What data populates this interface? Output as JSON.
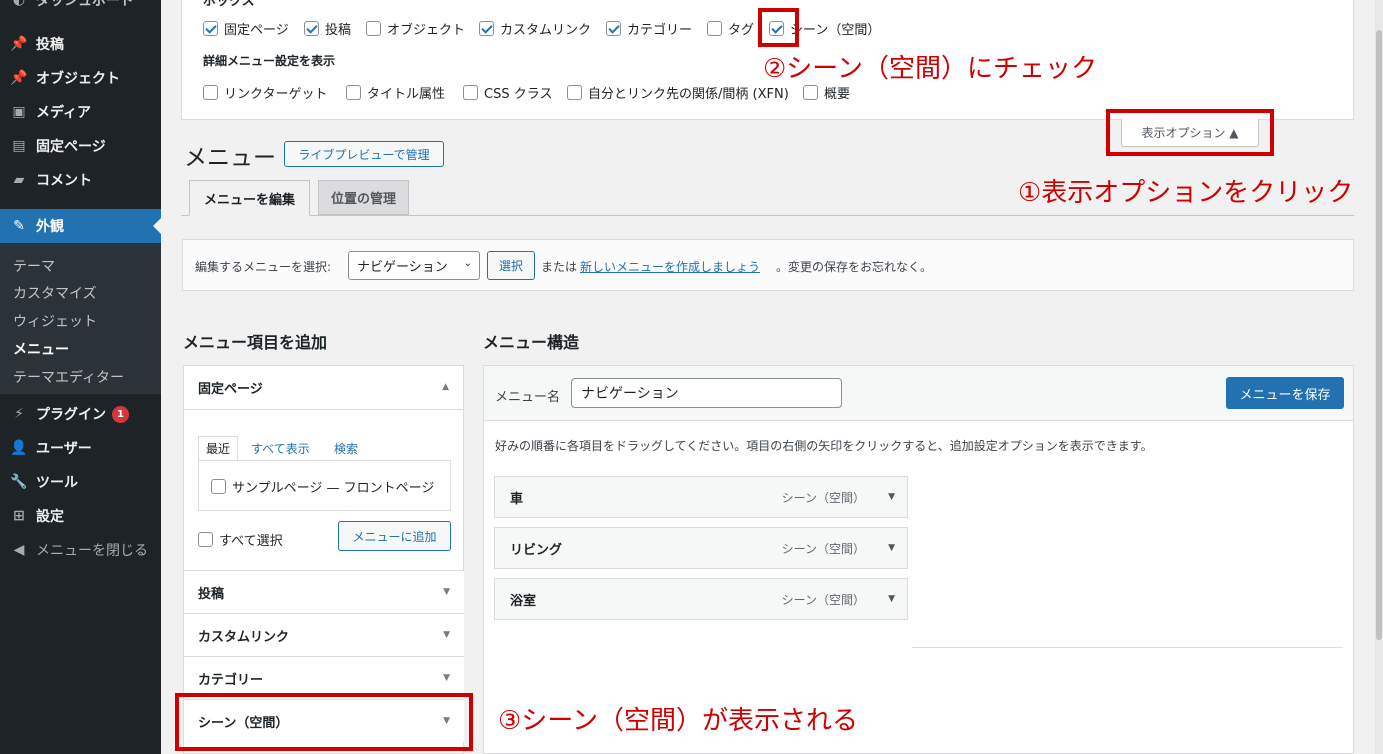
{
  "sidebar": {
    "top_partial": "ダッシュボード",
    "items": [
      {
        "label": "投稿",
        "icon": "pin-icon"
      },
      {
        "label": "オブジェクト",
        "icon": "pin-icon"
      },
      {
        "label": "メディア",
        "icon": "media-icon"
      },
      {
        "label": "固定ページ",
        "icon": "page-icon"
      },
      {
        "label": "コメント",
        "icon": "comment-icon"
      },
      {
        "label": "外観",
        "icon": "brush-icon"
      },
      {
        "label": "プラグイン",
        "icon": "plugin-icon",
        "badge": "1"
      },
      {
        "label": "ユーザー",
        "icon": "user-icon"
      },
      {
        "label": "ツール",
        "icon": "wrench-icon"
      },
      {
        "label": "設定",
        "icon": "settings-icon"
      },
      {
        "label": "メニューを閉じる",
        "icon": "collapse-icon"
      }
    ],
    "submenu": [
      "テーマ",
      "カスタマイズ",
      "ウィジェット",
      "メニュー",
      "テーマエディター"
    ]
  },
  "screen_options": {
    "boxes_heading": "ボックス",
    "boxes": [
      {
        "label": "固定ページ",
        "checked": true
      },
      {
        "label": "投稿",
        "checked": true
      },
      {
        "label": "オブジェクト",
        "checked": false
      },
      {
        "label": "カスタムリンク",
        "checked": true
      },
      {
        "label": "カテゴリー",
        "checked": true
      },
      {
        "label": "タグ",
        "checked": false
      },
      {
        "label": "シーン（空間）",
        "checked": true
      }
    ],
    "advanced_heading": "詳細メニュー設定を表示",
    "advanced": [
      {
        "label": "リンクターゲット",
        "checked": false
      },
      {
        "label": "タイトル属性",
        "checked": false
      },
      {
        "label": "CSS クラス",
        "checked": false
      },
      {
        "label": "自分とリンク先の関係/間柄 (XFN)",
        "checked": false
      },
      {
        "label": "概要",
        "checked": false
      }
    ],
    "toggle_label": "表示オプション ▲"
  },
  "header": {
    "title": "メニュー",
    "live_preview": "ライブプレビューで管理",
    "tabs": [
      "メニューを編集",
      "位置の管理"
    ]
  },
  "select_bar": {
    "label": "編集するメニューを選択:",
    "selected": "ナビゲーション",
    "select_button": "選択",
    "or_text": "または",
    "create_link": "新しいメニューを作成しましょう",
    "tail": "。変更の保存をお忘れなく。"
  },
  "add_items": {
    "heading": "メニュー項目を追加",
    "open_section": "固定ページ",
    "tabs": [
      "最近",
      "すべて表示",
      "検索"
    ],
    "page_item": "サンプルページ — フロントページ",
    "select_all": "すべて選択",
    "add_button": "メニューに追加",
    "sections": [
      "投稿",
      "カスタムリンク",
      "カテゴリー",
      "シーン（空間）"
    ]
  },
  "structure": {
    "heading": "メニュー構造",
    "name_label": "メニュー名",
    "name_value": "ナビゲーション",
    "save_button": "メニューを保存",
    "instructions": "好みの順番に各項目をドラッグしてください。項目の右側の矢印をクリックすると、追加設定オプションを表示できます。",
    "items": [
      {
        "title": "車",
        "type": "シーン（空間）"
      },
      {
        "title": "リビング",
        "type": "シーン（空間）"
      },
      {
        "title": "浴室",
        "type": "シーン（空間）"
      }
    ]
  },
  "annotations": {
    "step1": "①表示オプションをクリック",
    "step2": "②シーン（空間）にチェック",
    "step3": "③シーン（空間）が表示される",
    "color": "#d00000"
  }
}
